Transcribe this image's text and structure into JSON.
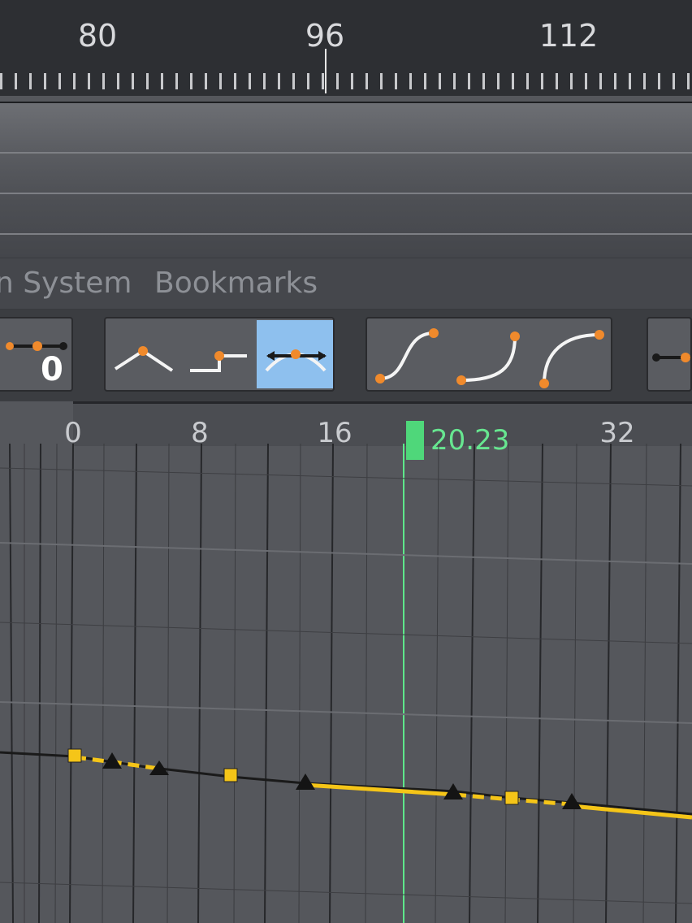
{
  "top_ruler": {
    "labels": [
      "80",
      "96",
      "112"
    ]
  },
  "menu": {
    "items": [
      "n System",
      "Bookmarks"
    ]
  },
  "toolbar": {
    "left_value": "0",
    "interpolation_buttons": [
      {
        "name": "interpolation-linear-peak",
        "active": false
      },
      {
        "name": "interpolation-step",
        "active": false
      },
      {
        "name": "interpolation-smooth-peak",
        "active": true
      }
    ],
    "easing_buttons": [
      {
        "name": "ease-in-out"
      },
      {
        "name": "ease-in"
      },
      {
        "name": "ease-out"
      }
    ]
  },
  "graph": {
    "ruler_labels": [
      "0",
      "8",
      "16",
      "32"
    ],
    "current_frame": "20.23"
  },
  "colors": {
    "active_button": "#8ec0ee",
    "keyframe_orange": "#f08a2c",
    "curve_yellow": "#f5c518",
    "playhead_green": "#5ee88a"
  }
}
